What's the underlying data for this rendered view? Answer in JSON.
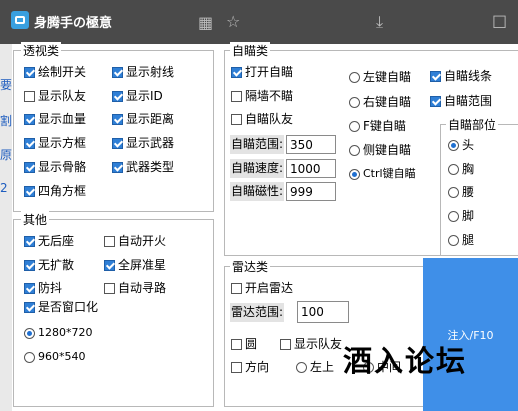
{
  "window": {
    "title": "身腾手の極意"
  },
  "background_chars": [
    "要",
    "割",
    "原",
    "2"
  ],
  "esp_group": {
    "title": "透视类",
    "items": [
      {
        "label": "绘制开关",
        "checked": true
      },
      {
        "label": "显示射线",
        "checked": true
      },
      {
        "label": "显示队友",
        "checked": false
      },
      {
        "label": "显示ID",
        "checked": true
      },
      {
        "label": "显示血量",
        "checked": true
      },
      {
        "label": "显示距离",
        "checked": true
      },
      {
        "label": "显示方框",
        "checked": true
      },
      {
        "label": "显示武器",
        "checked": true
      },
      {
        "label": "显示骨骼",
        "checked": true
      },
      {
        "label": "武器类型",
        "checked": true
      },
      {
        "label": "四角方框",
        "checked": true
      }
    ]
  },
  "other_group": {
    "title": "其他",
    "items": [
      {
        "label": "无后座",
        "checked": true
      },
      {
        "label": "自动开火",
        "checked": false
      },
      {
        "label": "无扩散",
        "checked": true
      },
      {
        "label": "全屏准星",
        "checked": true
      },
      {
        "label": "防抖",
        "checked": true
      },
      {
        "label": "自动寻路",
        "checked": false
      },
      {
        "label": "是否窗口化",
        "checked": true
      }
    ],
    "resolutions": [
      {
        "label": "1280*720",
        "selected": true
      },
      {
        "label": "960*540",
        "selected": false
      }
    ]
  },
  "aim_group": {
    "title": "自瞄类",
    "checks": [
      {
        "label": "打开自瞄",
        "checked": true
      },
      {
        "label": "隔墙不瞄",
        "checked": false
      },
      {
        "label": "自瞄队友",
        "checked": false
      }
    ],
    "fields": [
      {
        "label": "自瞄范围:",
        "value": "350"
      },
      {
        "label": "自瞄速度:",
        "value": "1000"
      },
      {
        "label": "自瞄磁性:",
        "value": "999"
      }
    ],
    "keys": [
      {
        "label": "左键自瞄",
        "selected": false
      },
      {
        "label": "右键自瞄",
        "selected": false
      },
      {
        "label": "F键自瞄",
        "selected": false
      },
      {
        "label": "侧键自瞄",
        "selected": false
      },
      {
        "label": "Ctrl键自瞄",
        "selected": true
      }
    ],
    "extra_checks": [
      {
        "label": "自瞄线条",
        "checked": true
      },
      {
        "label": "自瞄范围",
        "checked": true
      }
    ]
  },
  "aim_part_group": {
    "title": "自瞄部位",
    "parts": [
      {
        "label": "头",
        "selected": true
      },
      {
        "label": "胸",
        "selected": false
      },
      {
        "label": "腰",
        "selected": false
      },
      {
        "label": "脚",
        "selected": false
      },
      {
        "label": "腿",
        "selected": false
      }
    ]
  },
  "radar_group": {
    "title": "雷达类",
    "open_label": "开启雷达",
    "open_checked": false,
    "range_label": "雷达范围:",
    "range_value": "100",
    "options": [
      {
        "label": "圆",
        "checked": false
      },
      {
        "label": "显示队友",
        "checked": false
      },
      {
        "label": "方向",
        "checked": false
      }
    ],
    "positions": [
      {
        "label": "左上",
        "selected": false
      },
      {
        "label": "中间",
        "selected": false
      }
    ]
  },
  "inject_button": {
    "label": "注入/F10"
  },
  "watermark": "酒入论坛",
  "titlebar_glyphs": {
    "grid": "▦",
    "star": "☆",
    "download": "⤓",
    "box": "□",
    "close": "✕"
  }
}
